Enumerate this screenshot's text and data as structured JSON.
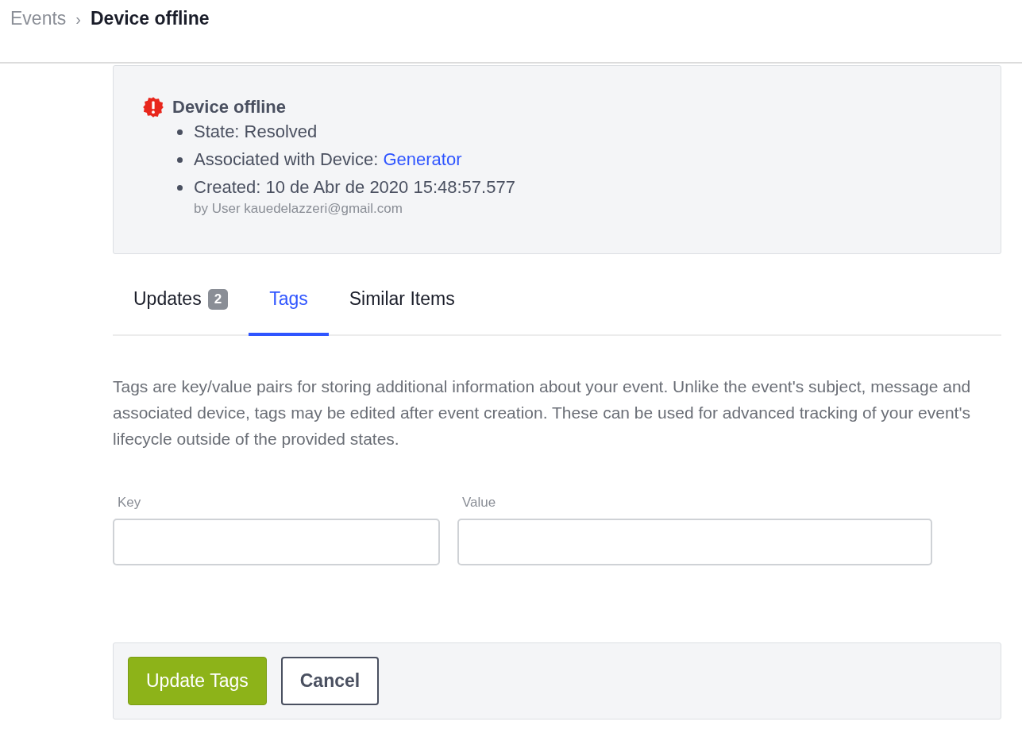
{
  "breadcrumb": [
    {
      "label": "Events",
      "current": false
    },
    {
      "label": "Device offline",
      "current": true
    }
  ],
  "breadcrumb_separator": "›",
  "event": {
    "title": "Device offline",
    "details": [
      {
        "text": "State: Resolved"
      },
      {
        "text": "Associated with Device: ",
        "link": "Generator"
      },
      {
        "text": "Created: 10 de Abr de 2020 15:48:57.577",
        "note": "by User kauedelazzeri@gmail.com"
      }
    ]
  },
  "tabs": [
    {
      "label": "Updates",
      "badge": "2",
      "selected": false
    },
    {
      "label": "Tags",
      "selected": true
    },
    {
      "label": "Similar Items",
      "selected": false
    }
  ],
  "description": "Tags are key/value pairs for storing additional information about your event. Unlike the event's subject, message and associated device, tags may be edited after event creation. These can be used for advanced tracking of your event's lifecycle outside of the provided states.",
  "fields": [
    {
      "label": "Key"
    },
    {
      "label": "Value"
    }
  ],
  "buttons": [
    {
      "label": "Update Tags",
      "kind": "primary"
    },
    {
      "label": "Cancel",
      "kind": "secondary"
    }
  ]
}
